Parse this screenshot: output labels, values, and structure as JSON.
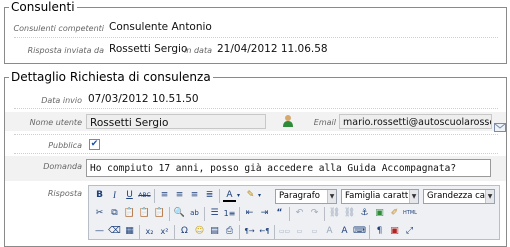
{
  "consulenti": {
    "legend": "Consulenti",
    "competenti_label": "Consulenti competenti",
    "competenti_value": "Consulente Antonio",
    "risposta_label": "Risposta inviata da",
    "risposta_value": "Rossetti Sergio",
    "data_label": "in data",
    "data_value": "21/04/2012 11.06.58"
  },
  "dettaglio": {
    "legend": "Dettaglio Richiesta di consulenza",
    "data_invio_label": "Data invio",
    "data_invio_value": "07/03/2012 10.51.50",
    "nome_utente_label": "Nome utente",
    "nome_utente_value": "Rossetti Sergio",
    "email_label": "Email",
    "email_value": "mario.rossetti@autoscuolarossetti",
    "pubblica_label": "Pubblica",
    "pubblica_checked": true,
    "domanda_label": "Domanda",
    "domanda_value": "Ho compiuto 17 anni, posso già accedere alla Guida Accompagnata?",
    "risposta_label": "Risposta"
  },
  "editor": {
    "format_value": "Paragrafo",
    "font_value": "Famiglia caratt",
    "size_value": "Grandezza cara"
  }
}
